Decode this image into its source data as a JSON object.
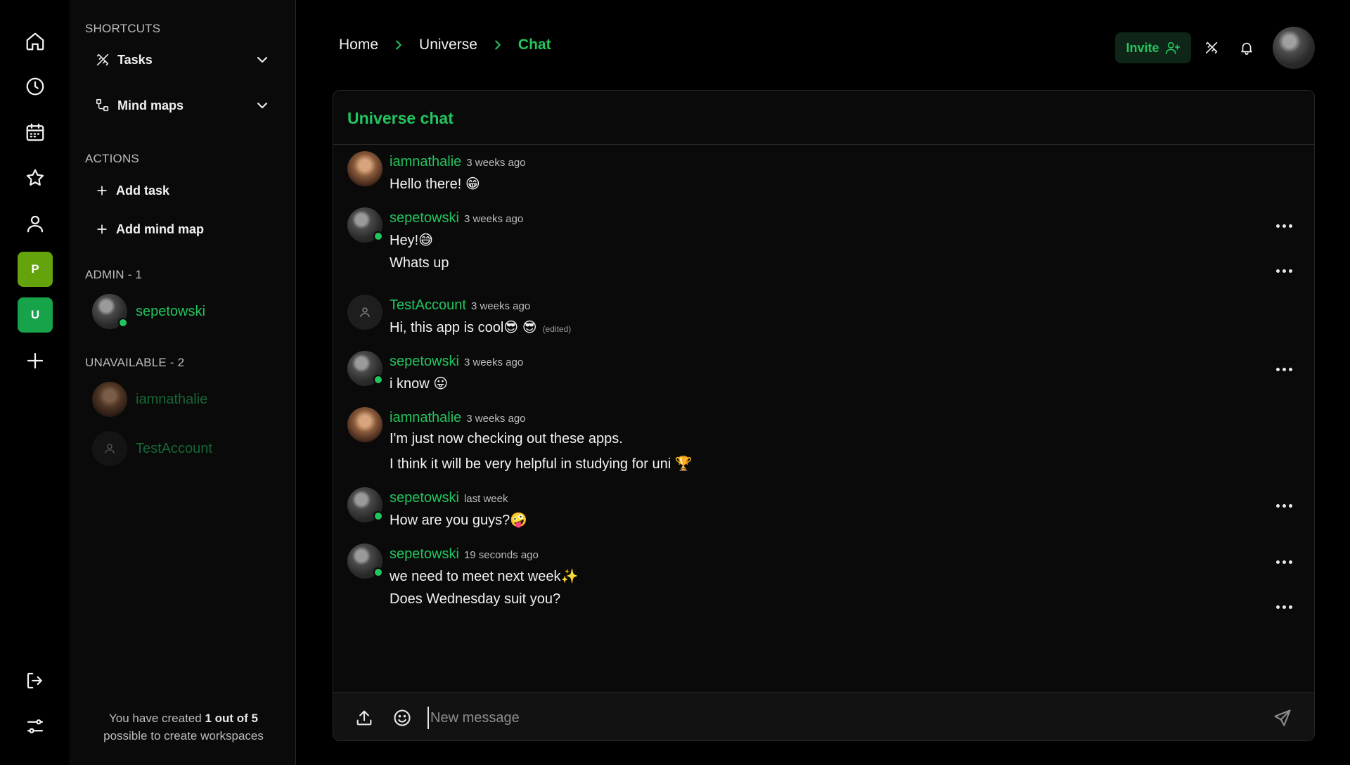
{
  "rail": {
    "icons": [
      "home-icon",
      "clock-icon",
      "calendar-icon",
      "star-icon",
      "user-icon"
    ],
    "workspaces": [
      {
        "letter": "P",
        "color": "#65a30d"
      },
      {
        "letter": "U",
        "color": "#16a34a"
      }
    ],
    "add_icon": "plus-icon",
    "bottom_icons": [
      "logout-icon",
      "settings-sliders-icon"
    ]
  },
  "panel": {
    "shortcuts_title": "SHORTCUTS",
    "shortcuts": [
      {
        "label": "Tasks",
        "icon": "tasks-icon"
      },
      {
        "label": "Mind maps",
        "icon": "mindmap-icon"
      }
    ],
    "actions_title": "ACTIONS",
    "actions": [
      {
        "label": "Add task"
      },
      {
        "label": "Add mind map"
      }
    ],
    "admin_title": "ADMIN - 1",
    "admins": [
      {
        "name": "sepetowski",
        "online": true
      }
    ],
    "unavailable_title": "UNAVAILABLE - 2",
    "unavailable": [
      {
        "name": "iamnathalie"
      },
      {
        "name": "TestAccount"
      }
    ],
    "footer": {
      "prefix": "You have created ",
      "bold": "1 out of 5",
      "suffix": "possible to create workspaces"
    }
  },
  "header": {
    "breadcrumb": [
      "Home",
      "Universe",
      "Chat"
    ],
    "invite_label": "Invite"
  },
  "chat": {
    "title": "Universe chat",
    "messages": [
      {
        "user": "iamnathalie",
        "time": "3 weeks ago",
        "lines": [
          "Hello there! 😁"
        ]
      },
      {
        "user": "sepetowski",
        "time": "3 weeks ago",
        "lines": [
          "Hey!😅",
          "Whats up"
        ]
      },
      {
        "user": "TestAccount",
        "time": "3 weeks ago",
        "lines": [
          "Hi, this app is cool😎 😎"
        ],
        "edited": "(edited)"
      },
      {
        "user": "sepetowski",
        "time": "3 weeks ago",
        "lines": [
          "i know 😛"
        ]
      },
      {
        "user": "iamnathalie",
        "time": "3 weeks ago",
        "lines": [
          "I'm just now checking out these apps.",
          "I think it will be very helpful in studying for uni 🏆"
        ]
      },
      {
        "user": "sepetowski",
        "time": "last week",
        "lines": [
          "How are you guys?🤪"
        ]
      },
      {
        "user": "sepetowski",
        "time": "19 seconds ago",
        "lines": [
          "we need to meet next week✨",
          "Does Wednesday suit you?"
        ]
      }
    ],
    "composer_placeholder": "New message"
  },
  "colors": {
    "accent": "#22c55e",
    "background": "#000000",
    "panel": "#0a0a0a"
  }
}
